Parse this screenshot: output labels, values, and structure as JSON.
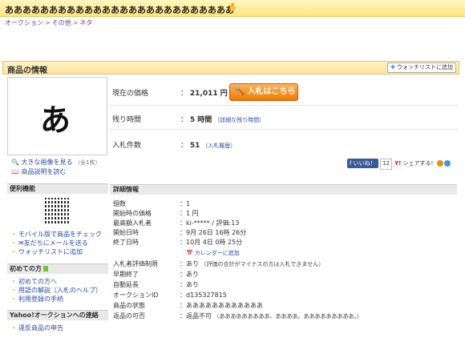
{
  "title": "ああああああああああああああああああああああああああ",
  "breadcrumbs": [
    "オークション",
    "その他",
    "ネタ"
  ],
  "section": {
    "title": "商品の情報",
    "watch_label": "ウォッチリストに追加"
  },
  "image": {
    "glyph": "あ",
    "links": {
      "enlarge": "大きな画像を見る",
      "count": "（全1枚）",
      "desc": "商品説明を読む"
    }
  },
  "price": {
    "current_label": "現在の価格",
    "current_value": "21,011 円",
    "bid_button": "入札はこちら",
    "remain_label": "残り時間",
    "remain_value": "5 時間",
    "remain_detail": "（詳細な残り時間）",
    "bids_label": "入札件数",
    "bids_value": "51",
    "bids_history": "（入札履歴）"
  },
  "share": {
    "like": "いいね！",
    "like_count": "12",
    "share_label": "シェアする!"
  },
  "convenience": {
    "title": "便利機能",
    "links": [
      "モバイル版で商品をチェック",
      "友だちにメールを送る",
      "ウォッチリストに追加"
    ]
  },
  "beginners": {
    "title": "初めての方",
    "links": [
      "初めての方へ",
      "用語の解説（入札のヘルプ）",
      "利用登録の手続"
    ]
  },
  "contact": {
    "title": "Yahoo!オークションへの連絡",
    "links": [
      "違反商品の申告"
    ]
  },
  "details": {
    "title": "詳細情報",
    "rows": [
      {
        "label": "個数",
        "value": "1"
      },
      {
        "label": "開始時の価格",
        "value": "1 円"
      },
      {
        "label": "最高額入札者",
        "value": "ki-***** / 評価:13"
      },
      {
        "label": "開始日時",
        "value": "9月 26日 16時 26分"
      },
      {
        "label": "終了日時",
        "value": "10月 4日 0時 25分"
      },
      {
        "label": "入札者評価制限",
        "value": "あり",
        "note": "（評価の合計がマイナスの方は入札できません）"
      },
      {
        "label": "早期終了",
        "value": "あり"
      },
      {
        "label": "自動延長",
        "value": "あり"
      },
      {
        "label": "オークションID",
        "value": "d135327815"
      },
      {
        "label": "商品の状態",
        "value": "ああああああああああああ"
      },
      {
        "label": "返品の可否",
        "value": "返品不可",
        "note": "（あああああああああ、ああああ。あああああああああ。）"
      }
    ],
    "calendar": "カレンダーに追加"
  }
}
